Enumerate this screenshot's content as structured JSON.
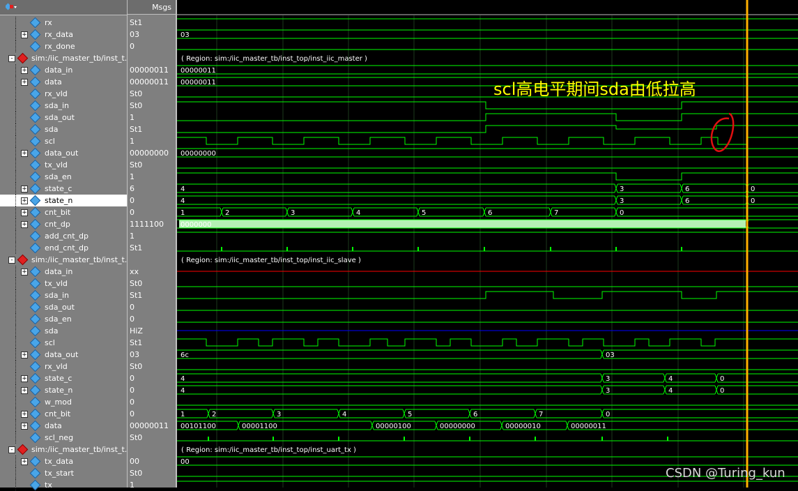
{
  "header": {
    "msgs_label": "Msgs"
  },
  "rows": [
    {
      "name": "rx",
      "value": "St1",
      "kind": "sig",
      "depth": 2,
      "expand": ""
    },
    {
      "name": "rx_data",
      "value": "03",
      "kind": "sig",
      "depth": 1,
      "expand": "+"
    },
    {
      "name": "rx_done",
      "value": "0",
      "kind": "sig",
      "depth": 2,
      "expand": ""
    },
    {
      "name": "sim:/iic_master_tb/inst_t...",
      "value": "",
      "kind": "reg",
      "depth": 0,
      "expand": "-"
    },
    {
      "name": "data_in",
      "value": "00000011",
      "kind": "sig",
      "depth": 1,
      "expand": "+"
    },
    {
      "name": "data",
      "value": "00000011",
      "kind": "sig",
      "depth": 1,
      "expand": "+"
    },
    {
      "name": "rx_vld",
      "value": "St0",
      "kind": "sig",
      "depth": 2,
      "expand": ""
    },
    {
      "name": "sda_in",
      "value": "St0",
      "kind": "sig",
      "depth": 2,
      "expand": ""
    },
    {
      "name": "sda_out",
      "value": "1",
      "kind": "sig",
      "depth": 2,
      "expand": ""
    },
    {
      "name": "sda",
      "value": "St1",
      "kind": "sig",
      "depth": 2,
      "expand": ""
    },
    {
      "name": "scl",
      "value": "1",
      "kind": "sig",
      "depth": 2,
      "expand": ""
    },
    {
      "name": "data_out",
      "value": "00000000",
      "kind": "sig",
      "depth": 1,
      "expand": "+"
    },
    {
      "name": "tx_vld",
      "value": "St0",
      "kind": "sig",
      "depth": 2,
      "expand": ""
    },
    {
      "name": "sda_en",
      "value": "1",
      "kind": "sig",
      "depth": 2,
      "expand": ""
    },
    {
      "name": "state_c",
      "value": "6",
      "kind": "sig",
      "depth": 1,
      "expand": "+"
    },
    {
      "name": "state_n",
      "value": "0",
      "kind": "sig",
      "depth": 1,
      "expand": "+",
      "selected": true
    },
    {
      "name": "cnt_bit",
      "value": "0",
      "kind": "sig",
      "depth": 1,
      "expand": "+"
    },
    {
      "name": "cnt_dp",
      "value": "1111100",
      "kind": "sig",
      "depth": 1,
      "expand": "+"
    },
    {
      "name": "add_cnt_dp",
      "value": "1",
      "kind": "sig",
      "depth": 2,
      "expand": ""
    },
    {
      "name": "end_cnt_dp",
      "value": "St1",
      "kind": "sig",
      "depth": 2,
      "expand": ""
    },
    {
      "name": "sim:/iic_master_tb/inst_t...",
      "value": "",
      "kind": "reg",
      "depth": 0,
      "expand": "-"
    },
    {
      "name": "data_in",
      "value": "xx",
      "kind": "sig",
      "depth": 1,
      "expand": "+"
    },
    {
      "name": "tx_vld",
      "value": "St0",
      "kind": "sig",
      "depth": 2,
      "expand": ""
    },
    {
      "name": "sda_in",
      "value": "St1",
      "kind": "sig",
      "depth": 2,
      "expand": ""
    },
    {
      "name": "sda_out",
      "value": "0",
      "kind": "sig",
      "depth": 2,
      "expand": ""
    },
    {
      "name": "sda_en",
      "value": "0",
      "kind": "sig",
      "depth": 2,
      "expand": ""
    },
    {
      "name": "sda",
      "value": "HiZ",
      "kind": "sig",
      "depth": 2,
      "expand": ""
    },
    {
      "name": "scl",
      "value": "St1",
      "kind": "sig",
      "depth": 2,
      "expand": ""
    },
    {
      "name": "data_out",
      "value": "03",
      "kind": "sig",
      "depth": 1,
      "expand": "+"
    },
    {
      "name": "rx_vld",
      "value": "St0",
      "kind": "sig",
      "depth": 2,
      "expand": ""
    },
    {
      "name": "state_c",
      "value": "0",
      "kind": "sig",
      "depth": 1,
      "expand": "+"
    },
    {
      "name": "state_n",
      "value": "0",
      "kind": "sig",
      "depth": 1,
      "expand": "+"
    },
    {
      "name": "w_mod",
      "value": "0",
      "kind": "sig",
      "depth": 2,
      "expand": ""
    },
    {
      "name": "cnt_bit",
      "value": "0",
      "kind": "sig",
      "depth": 1,
      "expand": "+"
    },
    {
      "name": "data",
      "value": "00000011",
      "kind": "sig",
      "depth": 1,
      "expand": "+"
    },
    {
      "name": "scl_neg",
      "value": "St0",
      "kind": "sig",
      "depth": 2,
      "expand": ""
    },
    {
      "name": "sim:/iic_master_tb/inst_t...",
      "value": "",
      "kind": "reg",
      "depth": 0,
      "expand": "-"
    },
    {
      "name": "tx_data",
      "value": "00",
      "kind": "sig",
      "depth": 1,
      "expand": "+"
    },
    {
      "name": "tx_start",
      "value": "St0",
      "kind": "sig",
      "depth": 2,
      "expand": ""
    },
    {
      "name": "tx",
      "value": "1",
      "kind": "sig",
      "depth": 2,
      "expand": ""
    }
  ],
  "wave_labels": {
    "rx_data": [
      "03"
    ],
    "region_master": "( Region: sim:/iic_master_tb/inst_top/inst_iic_master )",
    "data_in_m": [
      "00000011"
    ],
    "data_m": [
      "00000011"
    ],
    "data_out_m": [
      "00000000"
    ],
    "state_c_m": [
      "4",
      "3",
      "6",
      "0"
    ],
    "state_n_m": [
      "4",
      "3",
      "6",
      "0"
    ],
    "cnt_bit_m": [
      "1",
      "2",
      "3",
      "4",
      "5",
      "6",
      "7",
      "0"
    ],
    "cnt_dp_m": [
      "0000000"
    ],
    "region_slave": "( Region: sim:/iic_master_tb/inst_top/inst_iic_slave )",
    "data_out_s": [
      "6c",
      "03"
    ],
    "state_c_s": [
      "4",
      "3",
      "4",
      "0"
    ],
    "state_n_s": [
      "4",
      "3",
      "4",
      "0"
    ],
    "cnt_bit_s": [
      "1",
      "2",
      "3",
      "4",
      "5",
      "6",
      "7",
      "0"
    ],
    "data_s": [
      "00101100",
      "00001100",
      "00000100",
      "00000000",
      "00000010",
      "00000011"
    ],
    "region_uart": "( Region: sim:/iic_master_tb/inst_top/inst_uart_tx )",
    "tx_data": [
      "00"
    ]
  },
  "annotation": "scl高电平期间sda由低拉高",
  "watermark": "CSDN @Turing_kun",
  "colors": {
    "wave": "#00ff00",
    "hiz": "#0000ff",
    "x": "#ff0000",
    "cursor": "#ffb000",
    "selected": "#ffffff",
    "annotation": "#ffff00",
    "circle": "#e01010"
  }
}
